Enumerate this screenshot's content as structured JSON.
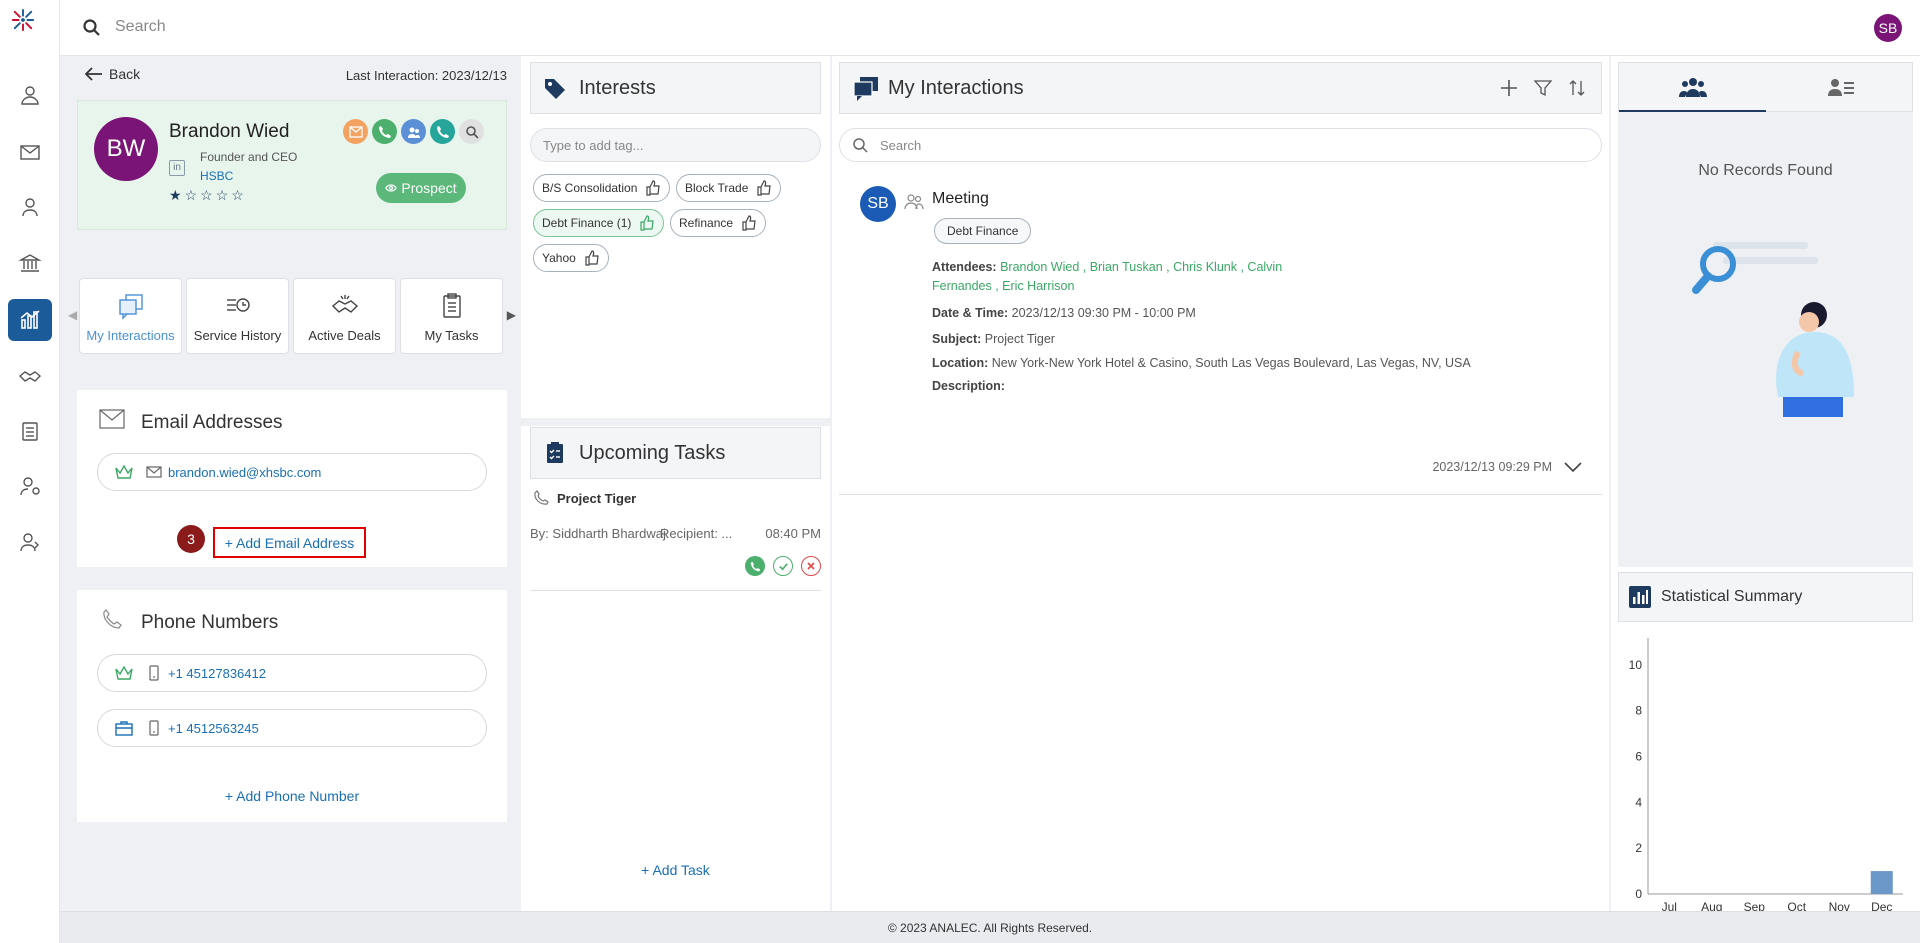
{
  "topbar": {
    "search_placeholder": "Search",
    "user_initials": "SB"
  },
  "rail": {
    "items": [
      "contacts",
      "mail",
      "person",
      "bank",
      "analytics",
      "deals",
      "tasks",
      "user-settings",
      "user-admin"
    ],
    "active": "analytics"
  },
  "header": {
    "back_label": "Back",
    "last_interaction": "Last Interaction: 2023/12/13"
  },
  "profile": {
    "initials": "BW",
    "name": "Brandon Wied",
    "title": "Founder and CEO",
    "company": "HSBC",
    "rating": 1,
    "rating_max": 5,
    "status": "Prospect"
  },
  "tabs": [
    {
      "label": "My Interactions",
      "active": true
    },
    {
      "label": "Service History",
      "active": false
    },
    {
      "label": "Active Deals",
      "active": false
    },
    {
      "label": "My Tasks",
      "active": false
    }
  ],
  "emails": {
    "title": "Email Addresses",
    "items": [
      "brandon.wied@xhsbc.com"
    ],
    "step_badge": "3",
    "add_label": "+ Add Email Address"
  },
  "phones": {
    "title": "Phone Numbers",
    "items": [
      "+1 45127836412",
      "+1 4512563245"
    ],
    "add_label": "+ Add Phone Number"
  },
  "interests": {
    "title": "Interests",
    "tag_placeholder": "Type to add tag...",
    "tags": [
      {
        "label": "B/S Consolidation",
        "highlighted": false
      },
      {
        "label": "Block Trade",
        "highlighted": false
      },
      {
        "label": "Debt Finance (1)",
        "highlighted": true
      },
      {
        "label": "Refinance",
        "highlighted": false
      },
      {
        "label": "Yahoo",
        "highlighted": false
      }
    ]
  },
  "tasks": {
    "title": "Upcoming Tasks",
    "item": {
      "name": "Project Tiger",
      "by": "By: Siddharth Bhardwaj",
      "recipient": "Recipient: ...",
      "time": "08:40 PM"
    },
    "add_label": "+ Add Task"
  },
  "interactions": {
    "title": "My Interactions",
    "search_placeholder": "Search",
    "item": {
      "initials": "SB",
      "type": "Meeting",
      "tag": "Debt Finance",
      "attendees_label": "Attendees:",
      "attendees_line1": "Brandon Wied , Brian Tuskan , Chris Klunk , Calvin",
      "attendees_line2": "Fernandes , Eric Harrison",
      "datetime_label": "Date & Time:",
      "datetime": "2023/12/13 09:30 PM - 10:00 PM",
      "subject_label": "Subject:",
      "subject": "Project Tiger",
      "location_label": "Location:",
      "location": "New York-New York Hotel & Casino, South Las Vegas Boulevard, Las Vegas, NV, USA",
      "description_label": "Description:",
      "timestamp": "2023/12/13 09:29 PM"
    }
  },
  "side": {
    "no_records": "No Records Found",
    "stat_title": "Statistical Summary"
  },
  "chart_data": {
    "type": "bar",
    "categories": [
      "Jul",
      "Aug",
      "Sep",
      "Oct",
      "Nov",
      "Dec"
    ],
    "values": [
      0,
      0,
      0,
      0,
      0,
      1
    ],
    "ylim": [
      0,
      11
    ],
    "yticks": [
      0,
      2,
      4,
      6,
      8,
      10
    ],
    "color": "#6b97c9"
  },
  "footer": {
    "copyright": "© 2023 ANALEC. All Rights Reserved."
  }
}
